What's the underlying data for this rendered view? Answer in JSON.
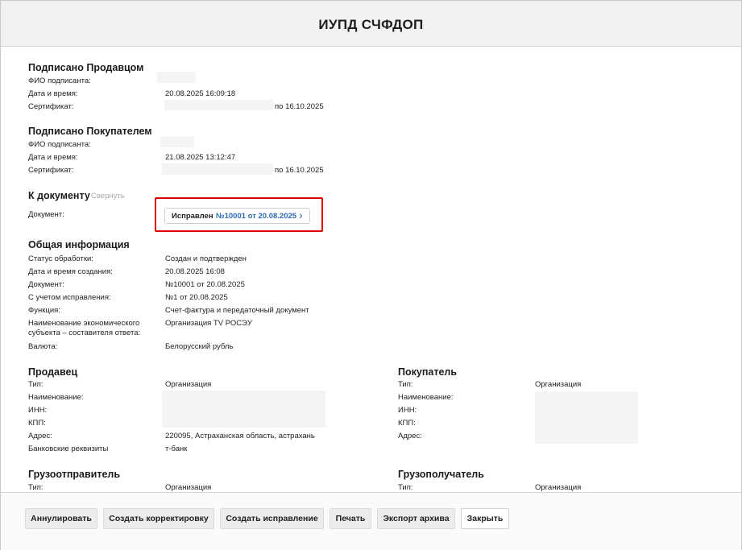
{
  "header": {
    "title": "ИУПД СЧФДОП"
  },
  "signed_seller": {
    "heading": "Подписано Продавцом",
    "fio_label": "ФИО подписанта:",
    "datetime_label": "Дата и время:",
    "datetime": "20.08.2025 16:09:18",
    "cert_label": "Сертификат:",
    "cert_until": "по 16.10.2025"
  },
  "signed_buyer": {
    "heading": "Подписано Покупателем",
    "fio_label": "ФИО подписанта:",
    "datetime_label": "Дата и время:",
    "datetime": "21.08.2025 13:12:47",
    "cert_label": "Сертификат:",
    "cert_until": "по 16.10.2025"
  },
  "to_document": {
    "heading": "К документу",
    "collapse": "Свернуть",
    "doc_label": "Документ:",
    "doc_state": "Исправлен",
    "doc_link": "№10001 от 20.08.2025",
    "chevron": "›"
  },
  "general": {
    "heading": "Общая информация",
    "rows": [
      {
        "label": "Статус обработки:",
        "value": "Создан и подтвержден"
      },
      {
        "label": "Дата и время создания:",
        "value": "20.08.2025 16:08"
      },
      {
        "label": "Документ:",
        "value": "№10001 от 20.08.2025"
      },
      {
        "label": "С учетом исправления:",
        "value": "№1 от 20.08.2025"
      },
      {
        "label": "Функция:",
        "value": "Счет-фактура и передаточный документ"
      },
      {
        "label": "Наименование экономического",
        "label2": "субъекта – составителя ответа:",
        "value": "Организация TV РОСЭУ"
      },
      {
        "label": "Валюта:",
        "value": "Белорусский рубль"
      }
    ]
  },
  "seller": {
    "heading": "Продавец",
    "type_label": "Тип:",
    "type": "Организация",
    "name_label": "Наименование:",
    "inn_label": "ИНН:",
    "kpp_label": "КПП:",
    "address_label": "Адрес:",
    "address": "220095, Астраханская область, астрахань",
    "bank_label": "Банковские реквизиты",
    "bank": "т-банк"
  },
  "buyer": {
    "heading": "Покупатель",
    "type_label": "Тип:",
    "type": "Организация",
    "name_label": "Наименование:",
    "inn_label": "ИНН:",
    "kpp_label": "КПП:",
    "address_label": "Адрес:"
  },
  "shipper": {
    "heading": "Грузоотправитель",
    "type_label": "Тип:",
    "type": "Организация"
  },
  "consignee": {
    "heading": "Грузополучатель",
    "type_label": "Тип:",
    "type": "Организация"
  },
  "footer": {
    "annul": "Аннулировать",
    "create_correction": "Создать корректировку",
    "create_fix": "Создать исправление",
    "print": "Печать",
    "export": "Экспорт архива",
    "close": "Закрыть"
  }
}
